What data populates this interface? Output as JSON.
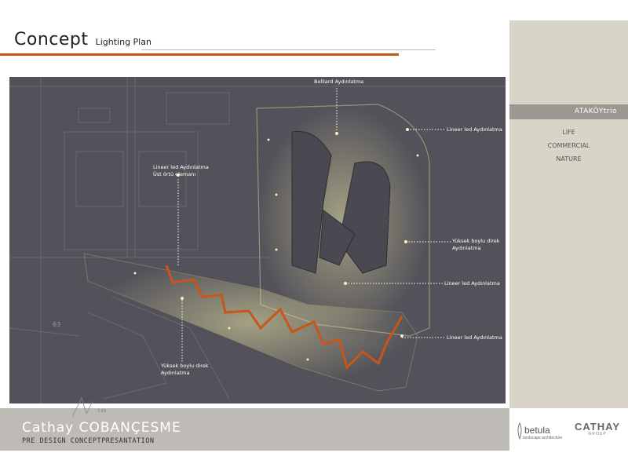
{
  "header": {
    "title": "Concept",
    "subtitle": "Lighting Plan"
  },
  "plan": {
    "labels": {
      "bollard": "Bolliard Aydınlatma",
      "lineer_top_right": "Lineer led Aydınlatma",
      "lineer_ust_line1": "Lineer led Aydınlatma",
      "lineer_ust_line2": "Üst örtü elemanı",
      "yuksek_right_line1": "Yüksek boylu direk",
      "yuksek_right_line2": "Aydınlatma",
      "lineer_mid_right": "Lineer led Aydınlatma",
      "lineer_low_right": "Lineer led Aydınlatma",
      "yuksek_left_line1": "Yüksek boylu direk",
      "yuksek_left_line2": "Aydınlatma"
    },
    "plan_numbers": [
      "63",
      "7.43"
    ],
    "colors": {
      "background": "#535159",
      "lighting_path": "#c8551a",
      "glow": "#e6e2a4"
    }
  },
  "sidebar": {
    "project": "ATAKÖYtrio",
    "items": [
      "LIFE",
      "COMMERCIAL",
      "NATURE"
    ]
  },
  "footer": {
    "title": "Cathay COBANÇESME",
    "subtitle": "PRE DESIGN CONCEPTPRESANTATION",
    "logo_betula_name": "betula",
    "logo_betula_tag": "landscape architecture",
    "logo_cathay_name": "CATHAY",
    "logo_cathay_tag": "GROUP"
  },
  "colors": {
    "accent": "#c8551a",
    "sidebar_bg": "#d9d4c8",
    "sidebar_header": "#9c9790",
    "footer_bg": "#bebbb7"
  }
}
